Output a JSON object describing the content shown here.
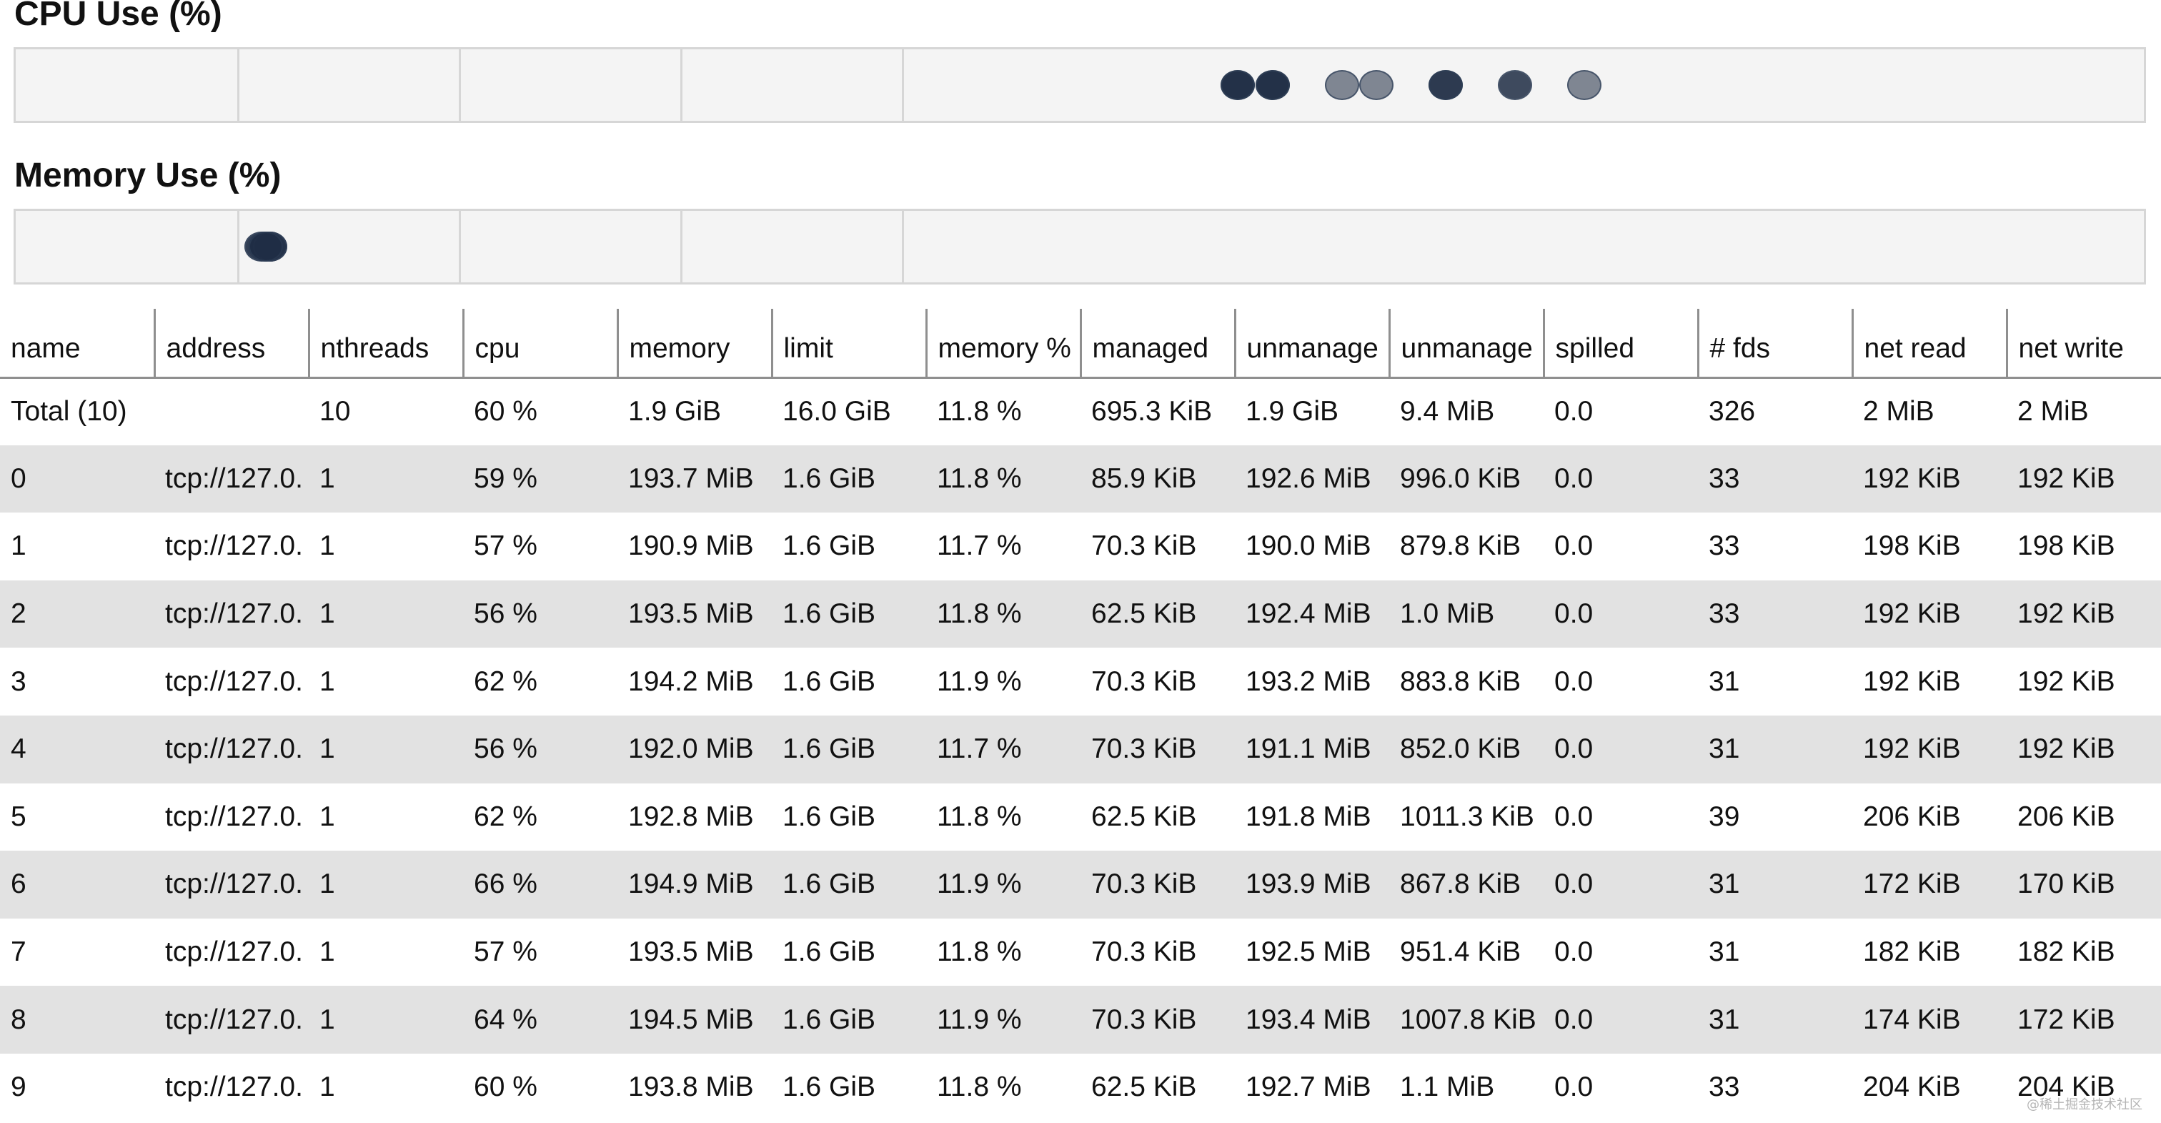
{
  "cpu_chart": {
    "title": "CPU Use (%)",
    "dot_colors": [
      "#1f2d45",
      "#6b7382"
    ],
    "values": [
      {
        "worker": "0",
        "value": 59
      },
      {
        "worker": "1",
        "value": 57
      },
      {
        "worker": "2",
        "value": 56
      },
      {
        "worker": "3",
        "value": 62
      },
      {
        "worker": "4",
        "value": 56
      },
      {
        "worker": "5",
        "value": 62
      },
      {
        "worker": "6",
        "value": 66
      },
      {
        "worker": "7",
        "value": 57
      },
      {
        "worker": "8",
        "value": 64
      },
      {
        "worker": "9",
        "value": 60
      }
    ]
  },
  "memory_chart": {
    "title": "Memory Use (%)",
    "dot_color": "#1f2d45",
    "values": [
      {
        "worker": "0",
        "value": 11.8
      },
      {
        "worker": "1",
        "value": 11.7
      },
      {
        "worker": "2",
        "value": 11.8
      },
      {
        "worker": "3",
        "value": 11.9
      },
      {
        "worker": "4",
        "value": 11.7
      },
      {
        "worker": "5",
        "value": 11.8
      },
      {
        "worker": "6",
        "value": 11.9
      },
      {
        "worker": "7",
        "value": 11.8
      },
      {
        "worker": "8",
        "value": 11.9
      },
      {
        "worker": "9",
        "value": 11.8
      }
    ]
  },
  "table": {
    "columns": [
      "name",
      "address",
      "nthreads",
      "cpu",
      "memory",
      "limit",
      "memory %",
      "managed",
      "unmanage",
      "unmanage",
      "spilled",
      "# fds",
      "net read",
      "net write"
    ],
    "rows": [
      [
        "Total (10)",
        "",
        "10",
        "60 %",
        "1.9 GiB",
        "16.0 GiB",
        "11.8 %",
        "695.3 KiB",
        "1.9 GiB",
        "9.4 MiB",
        "0.0",
        "326",
        "2 MiB",
        "2 MiB"
      ],
      [
        "0",
        "tcp://127.0.",
        "1",
        "59 %",
        "193.7 MiB",
        "1.6 GiB",
        "11.8 %",
        "85.9 KiB",
        "192.6 MiB",
        "996.0 KiB",
        "0.0",
        "33",
        "192 KiB",
        "192 KiB"
      ],
      [
        "1",
        "tcp://127.0.",
        "1",
        "57 %",
        "190.9 MiB",
        "1.6 GiB",
        "11.7 %",
        "70.3 KiB",
        "190.0 MiB",
        "879.8 KiB",
        "0.0",
        "33",
        "198 KiB",
        "198 KiB"
      ],
      [
        "2",
        "tcp://127.0.",
        "1",
        "56 %",
        "193.5 MiB",
        "1.6 GiB",
        "11.8 %",
        "62.5 KiB",
        "192.4 MiB",
        "1.0 MiB",
        "0.0",
        "33",
        "192 KiB",
        "192 KiB"
      ],
      [
        "3",
        "tcp://127.0.",
        "1",
        "62 %",
        "194.2 MiB",
        "1.6 GiB",
        "11.9 %",
        "70.3 KiB",
        "193.2 MiB",
        "883.8 KiB",
        "0.0",
        "31",
        "192 KiB",
        "192 KiB"
      ],
      [
        "4",
        "tcp://127.0.",
        "1",
        "56 %",
        "192.0 MiB",
        "1.6 GiB",
        "11.7 %",
        "70.3 KiB",
        "191.1 MiB",
        "852.0 KiB",
        "0.0",
        "31",
        "192 KiB",
        "192 KiB"
      ],
      [
        "5",
        "tcp://127.0.",
        "1",
        "62 %",
        "192.8 MiB",
        "1.6 GiB",
        "11.8 %",
        "62.5 KiB",
        "191.8 MiB",
        "1011.3 KiB",
        "0.0",
        "39",
        "206 KiB",
        "206 KiB"
      ],
      [
        "6",
        "tcp://127.0.",
        "1",
        "66 %",
        "194.9 MiB",
        "1.6 GiB",
        "11.9 %",
        "70.3 KiB",
        "193.9 MiB",
        "867.8 KiB",
        "0.0",
        "31",
        "172 KiB",
        "170 KiB"
      ],
      [
        "7",
        "tcp://127.0.",
        "1",
        "57 %",
        "193.5 MiB",
        "1.6 GiB",
        "11.8 %",
        "70.3 KiB",
        "192.5 MiB",
        "951.4 KiB",
        "0.0",
        "31",
        "182 KiB",
        "182 KiB"
      ],
      [
        "8",
        "tcp://127.0.",
        "1",
        "64 %",
        "194.5 MiB",
        "1.6 GiB",
        "11.9 %",
        "70.3 KiB",
        "193.4 MiB",
        "1007.8 KiB",
        "0.0",
        "31",
        "174 KiB",
        "172 KiB"
      ],
      [
        "9",
        "tcp://127.0.",
        "1",
        "60 %",
        "193.8 MiB",
        "1.6 GiB",
        "11.8 %",
        "62.5 KiB",
        "192.7 MiB",
        "1.1 MiB",
        "0.0",
        "33",
        "204 KiB",
        "204 KiB"
      ]
    ]
  },
  "watermark": "@稀土掘金技术社区"
}
